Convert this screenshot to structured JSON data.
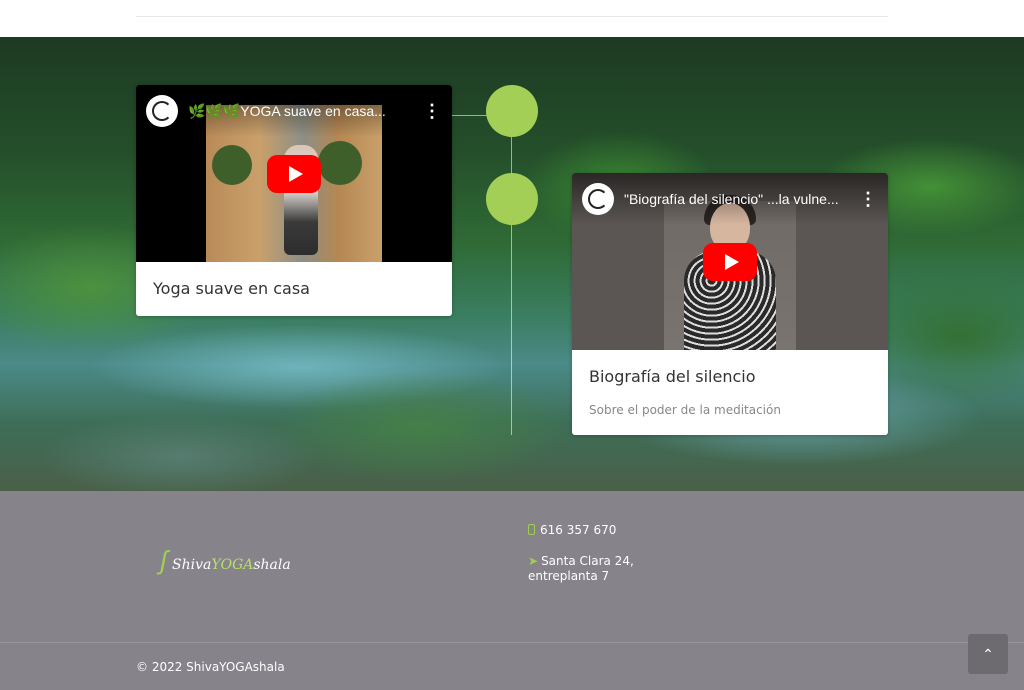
{
  "timeline": {
    "items": [
      {
        "video_title": "🌿🌿🌿YOGA suave en casa...",
        "title": "Yoga suave en casa",
        "subtitle": ""
      },
      {
        "video_title": "\"Biografía del silencio\" ...la vulne...",
        "title": "Biografía del silencio",
        "subtitle": "Sobre el poder de la meditación"
      }
    ],
    "accent_color": "#a3cf57"
  },
  "video_ui": {
    "menu_glyph": "⋮",
    "play_color": "#ff0000"
  },
  "footer": {
    "logo": {
      "part1": "Shiva",
      "part2": "YOGA",
      "part3": "shala"
    },
    "phone": "616 357 670",
    "address": "Santa Clara 24, entreplanta 7",
    "copyright": "© 2022 ShivaYOGAshala",
    "scroll_top_glyph": "⌃",
    "background_color": "#86838a"
  },
  "icons": {
    "phone": "phone-icon",
    "address": "location-arrow-icon",
    "scroll_top": "chevron-up-icon"
  }
}
